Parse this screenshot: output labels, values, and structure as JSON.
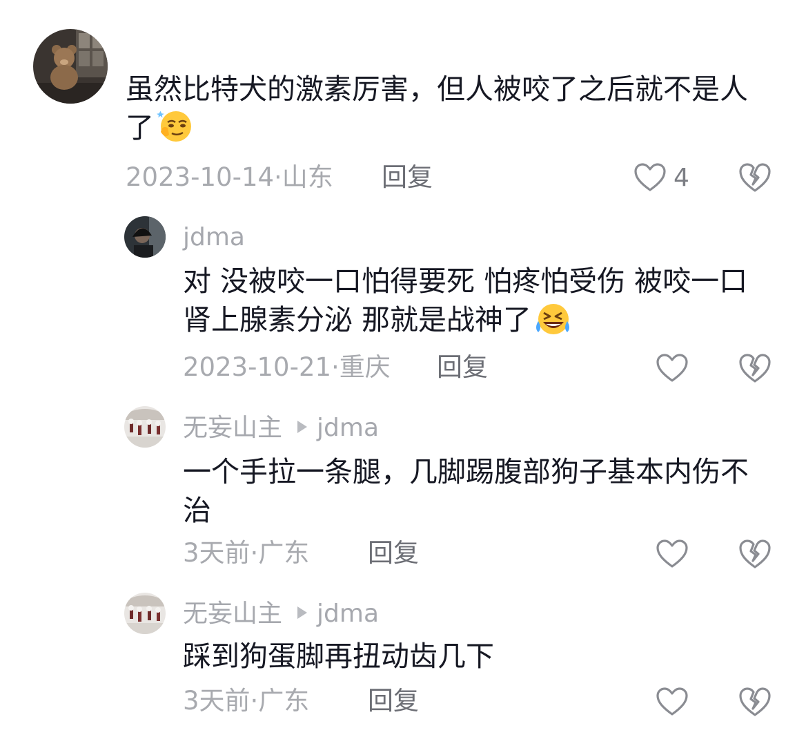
{
  "comments": [
    {
      "author": "",
      "text": "虽然比特犬的激素厉害，但人被咬了之后就不是人了",
      "emoji": "smug-face-emoji",
      "date": "2023-10-14",
      "location": "山东",
      "reply_label": "回复",
      "likes": "4"
    },
    {
      "author": "jdma",
      "text": "对 没被咬一口怕得要死 怕疼怕受伤 被咬一口 肾上腺素分泌 那就是战神了",
      "emoji": "rolling-laughing-emoji",
      "date": "2023-10-21",
      "location": "重庆",
      "reply_label": "回复",
      "likes": ""
    },
    {
      "author": "无妄山主",
      "reply_to": "jdma",
      "text": "一个手拉一条腿，几脚踢腹部狗子基本内伤不治",
      "date": "3天前",
      "location": "广东",
      "reply_label": "回复",
      "likes": ""
    },
    {
      "author": "无妄山主",
      "reply_to": "jdma",
      "text": "踩到狗蛋脚再扭动齿几下",
      "date": "3天前",
      "location": "广东",
      "reply_label": "回复",
      "likes": ""
    }
  ],
  "meta_separator": "·",
  "colors": {
    "text": "#161823",
    "meta": "#a8aaaf",
    "reply": "#6c6e75",
    "icon": "#8a8c92"
  },
  "icons": [
    "heart-icon",
    "broken-heart-icon",
    "reply-arrow-icon"
  ]
}
